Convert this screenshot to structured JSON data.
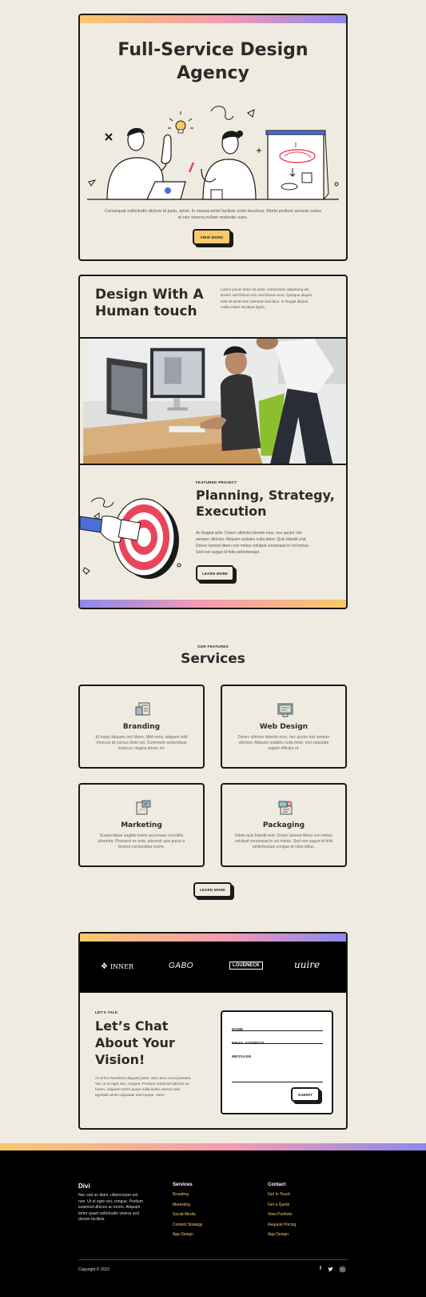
{
  "hero": {
    "title_line1": "Full-Service Design",
    "title_line2": "Agency",
    "desc_line1": "Consequat sollicitudin dictum id justo, amet. In massa amet facilisis enim faucibus. Morbi pretium aenean netus",
    "desc_line2": "at nec viverra nullam molestie nunc.",
    "button": "VIEW WORK"
  },
  "human": {
    "title_line1": "Design With A",
    "title_line2": "Human touch",
    "desc": [
      "Lorem ipsum dolor sit amet, consectetur adipiscing elit.",
      "Donec sed finibus nisi, sed dictum eros. Quisque aliquet",
      "velit sit amet sem interdum faucibus. In feugiat aliquet",
      "mollis etiam tincidunt ligula."
    ]
  },
  "featured": {
    "eyebrow": "FEATURED PROJECT",
    "title_line1": "Planning, Strategy,",
    "title_line2": "Execution",
    "desc": [
      "Ac feugiat ante. Donec ultricies lobortis eros, nec auctor nisl",
      "semper ultricies. Aliquam sodales nulla dolor. Quis blandit erat.",
      "Donec laoreet libero non metus volutpat consequat in vel metus.",
      "Sed non augue id felis pellentesque."
    ],
    "button": "LEARN MORE"
  },
  "services": {
    "eyebrow": "OUR FEATURES",
    "title": "Services",
    "button": "LEARN MORE",
    "items": [
      {
        "title": "Branding",
        "desc": [
          "Et turpis aliquam orci libero. Nibh eros, aliquam velit",
          "rhoncus sit cursus dolor vel. Commodo scelerisque",
          "rhoncus, magna donec mi."
        ]
      },
      {
        "title": "Web Design",
        "desc": [
          "Donec ultricies lobortis eros, nec auctor nisl semper",
          "ultricies. Aliquam sodales nulla dolor, sed vulputate",
          "sapien efficitur ut."
        ]
      },
      {
        "title": "Marketing",
        "desc": [
          "Suspendisse sagittis lorem accumsan convallis",
          "pharetra. Praesent ex ante, placerat quis purus a",
          "tempor consectetur lorem."
        ]
      },
      {
        "title": "Packaging",
        "desc": [
          "Etiam quis blandit erat. Donec laoreet libero non metus",
          "volutpat consequat in vel metus. Sed non augue id felis",
          "pellentesque congue et vitae tellus."
        ]
      }
    ]
  },
  "logos": [
    "INNER",
    "GABO",
    "LOUDNECK",
    "uuire"
  ],
  "chat": {
    "eyebrow": "LET'S TALK",
    "title_line1": "Let’s Chat",
    "title_line2": "About Your",
    "title_line3": "Vision!",
    "desc": [
      "At ut leo hendrerit aliquam justo, sem arcu urna posuere.",
      "Vel, ut et eget nisi, congue. Pretium euismod ultrices ac",
      "lorem. Aliquam tortor quam sollicitudin viverra sed",
      "egestas amet vulputate sed neque, nunc."
    ],
    "form": {
      "name": "NAME",
      "email": "EMAIL ADDRESS",
      "message": "MESSAGE",
      "submit": "SUBMIT"
    }
  },
  "footer": {
    "brand": "Divi",
    "about": [
      "Nec sed ac diam, ullamcorper est",
      "non. Ut et eget nisi, congue. Pretium",
      "euismod ultrices ac lorem. Aliquam",
      "tortor quam sollicitudin viverra sed",
      "dictum facilisis."
    ],
    "services_title": "Services",
    "services": [
      "Branding",
      "Marketing",
      "Social Media",
      "Content Strategy",
      "App Design"
    ],
    "contact_title": "Contact",
    "contact": [
      "Get In Touch",
      "Get a Quote",
      "View Portfolio",
      "Request Pricing",
      "App Design"
    ],
    "copyright": "Copyright © 2022",
    "social": [
      "facebook-icon",
      "twitter-icon",
      "instagram-icon"
    ]
  },
  "colors": {
    "yellow": "#f7c96a",
    "pink": "#f49ab3",
    "purple": "#8b88ee",
    "cream": "#f0ebe0",
    "dark": "#1a1a1a"
  }
}
